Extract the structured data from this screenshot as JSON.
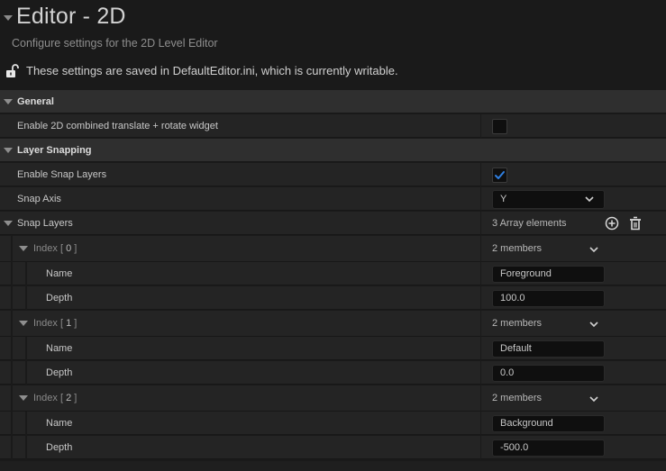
{
  "header": {
    "title": "Editor - 2D",
    "subtitle": "Configure settings for the 2D Level Editor",
    "notice": "These settings are saved in DefaultEditor.ini, which is currently writable.",
    "notice_icon": "unlocked-padlock-icon"
  },
  "sections": {
    "general": {
      "label": "General",
      "enable_combined_widget": {
        "label": "Enable 2D combined translate + rotate widget",
        "checked": false
      }
    },
    "layer_snapping": {
      "label": "Layer Snapping",
      "enable_snap_layers": {
        "label": "Enable Snap Layers",
        "checked": true
      },
      "snap_axis": {
        "label": "Snap Axis",
        "value": "Y"
      },
      "snap_layers": {
        "label": "Snap Layers",
        "summary": "3 Array elements",
        "add_icon": "add-circle-icon",
        "delete_icon": "trash-icon",
        "elements": [
          {
            "label_prefix": "Index [ ",
            "index": "0",
            "label_suffix": " ]",
            "summary": "2 members",
            "name_label": "Name",
            "name": "Foreground",
            "depth_label": "Depth",
            "depth": "100.0"
          },
          {
            "label_prefix": "Index [ ",
            "index": "1",
            "label_suffix": " ]",
            "summary": "2 members",
            "name_label": "Name",
            "name": "Default",
            "depth_label": "Depth",
            "depth": "0.0"
          },
          {
            "label_prefix": "Index [ ",
            "index": "2",
            "label_suffix": " ]",
            "summary": "2 members",
            "name_label": "Name",
            "name": "Background",
            "depth_label": "Depth",
            "depth": "-500.0"
          }
        ]
      }
    }
  },
  "colors": {
    "accent_check": "#2f7fe0",
    "background": "#1a1a1a",
    "row": "#242424",
    "category_row": "#2f2f2f"
  }
}
